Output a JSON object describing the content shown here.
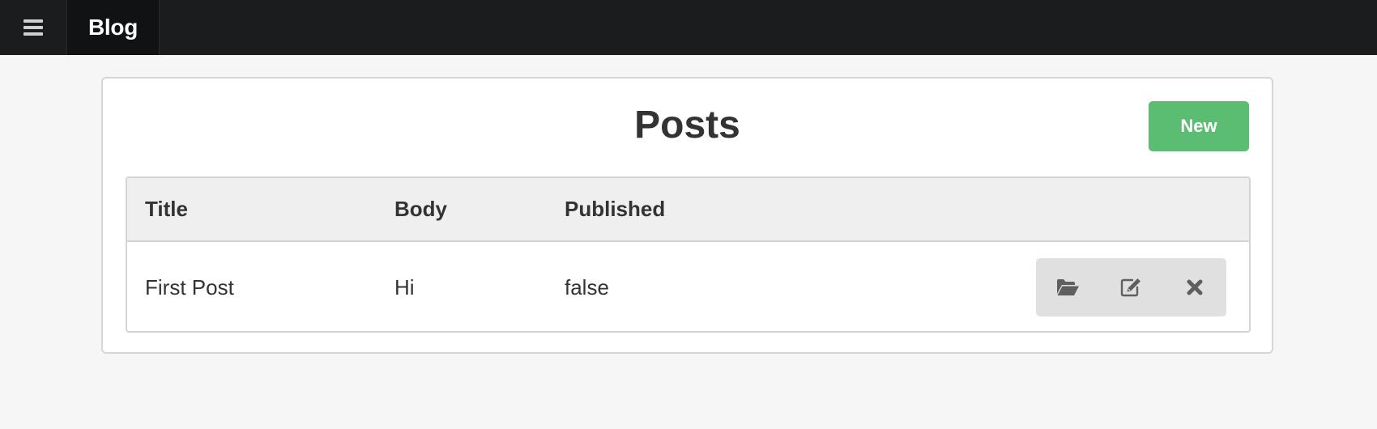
{
  "navbar": {
    "menu_icon": "hamburger-icon",
    "brand": "Blog"
  },
  "page": {
    "title": "Posts",
    "new_button": "New"
  },
  "table": {
    "columns": [
      "Title",
      "Body",
      "Published"
    ],
    "rows": [
      {
        "title": "First Post",
        "body": "Hi",
        "published": "false",
        "actions": [
          "open-folder-icon",
          "edit-icon",
          "delete-icon"
        ]
      }
    ]
  },
  "colors": {
    "navbar_bg": "#1b1c1e",
    "brand_bg": "#111213",
    "page_bg": "#f6f6f6",
    "primary_green": "#5bbd72",
    "header_bg": "#efefef",
    "action_group_bg": "#e0e0e0"
  }
}
